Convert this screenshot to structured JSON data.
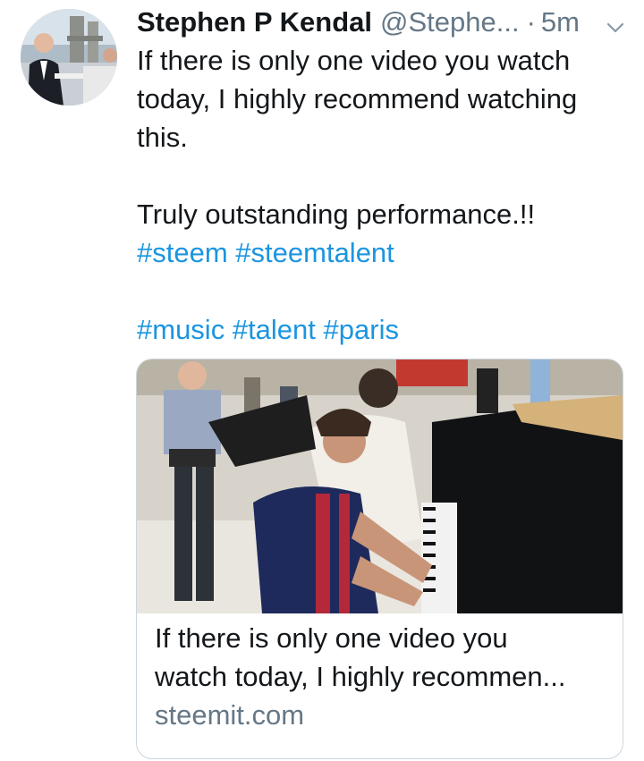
{
  "tweet": {
    "author_name": "Stephen P Kendal",
    "author_handle": "@Stephe...",
    "separator": "·",
    "timestamp": "5m",
    "text_lines": [
      "If there is only one video you watch",
      "today, I highly recommend watching",
      "this.",
      "Truly outstanding performance.!!"
    ],
    "hashtags_row1": [
      "#steem",
      "#steemtalent"
    ],
    "hashtags_row2": [
      "#music",
      "#talent",
      "#paris"
    ]
  },
  "card": {
    "title_line1": "If there is only one video you",
    "title_line2": "watch today, I highly recommen...",
    "domain": "steemit.com"
  },
  "icons": {
    "avatar": "profile-photo",
    "caret": "chevron-down-icon"
  },
  "colors": {
    "link": "#1b95e0",
    "secondary": "#657786",
    "border": "#ccd6dd"
  }
}
